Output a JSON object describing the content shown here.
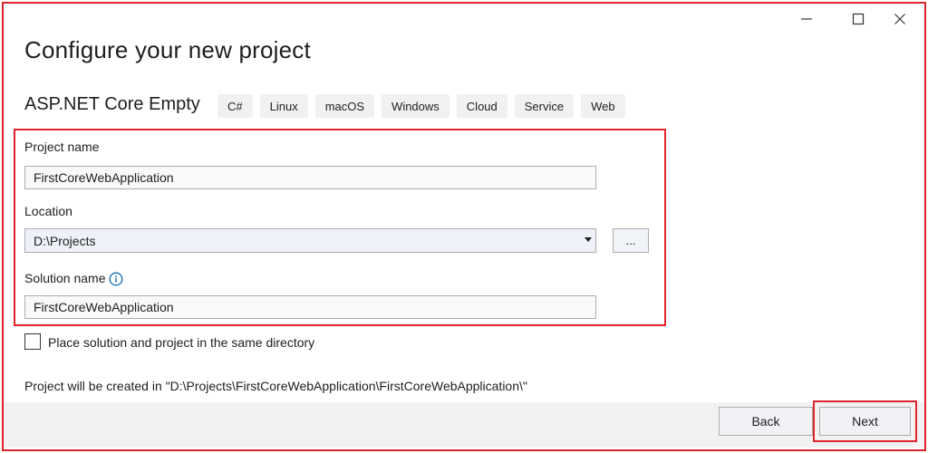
{
  "window": {
    "controls": [
      {
        "name": "minimize-icon"
      },
      {
        "name": "maximize-icon"
      },
      {
        "name": "close-icon"
      }
    ]
  },
  "header": {
    "title": "Configure your new project",
    "template_name": "ASP.NET Core Empty",
    "tags": [
      "C#",
      "Linux",
      "macOS",
      "Windows",
      "Cloud",
      "Service",
      "Web"
    ]
  },
  "form": {
    "project_name_label": "Project name",
    "project_name_value": "FirstCoreWebApplication",
    "location_label": "Location",
    "location_value": "D:\\Projects",
    "browse_label": "...",
    "solution_name_label": "Solution name",
    "solution_name_value": "FirstCoreWebApplication",
    "same_directory_label": "Place solution and project in the same directory",
    "same_directory_checked": false
  },
  "info": {
    "path_text": "Project will be created in \"D:\\Projects\\FirstCoreWebApplication\\FirstCoreWebApplication\\\""
  },
  "footer": {
    "back_label": "Back",
    "next_label": "Next"
  },
  "colors": {
    "highlight": "#e0242b",
    "info_icon": "#1a6fc0"
  }
}
